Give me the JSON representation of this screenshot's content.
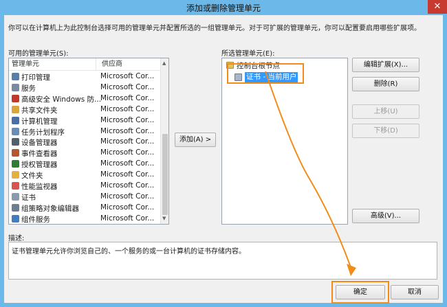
{
  "window": {
    "title": "添加或删除管理单元",
    "close_glyph": "✕"
  },
  "intro_text": "你可以在计算机上为此控制台选择可用的管理单元并配置所选的一组管理单元。对于可扩展的管理单元，你可以配置要启用哪些扩展项。",
  "available": {
    "label": "可用的管理单元(S):",
    "columns": [
      "管理单元",
      "供应商"
    ],
    "items": [
      {
        "name": "打印管理",
        "vendor": "Microsoft Cor...",
        "icon": "printer-icon",
        "color": "#5b7ea6"
      },
      {
        "name": "服务",
        "vendor": "Microsoft Cor...",
        "icon": "services-icon",
        "color": "#7a8aa0"
      },
      {
        "name": "高级安全 Windows 防...",
        "vendor": "Microsoft Cor...",
        "icon": "firewall-icon",
        "color": "#c0392b"
      },
      {
        "name": "共享文件夹",
        "vendor": "Microsoft Cor...",
        "icon": "shared-folder-icon",
        "color": "#d8a63b"
      },
      {
        "name": "计算机管理",
        "vendor": "Microsoft Cor...",
        "icon": "computer-management-icon",
        "color": "#4a6fa5"
      },
      {
        "name": "任务计划程序",
        "vendor": "Microsoft Cor...",
        "icon": "task-scheduler-icon",
        "color": "#6b8db5"
      },
      {
        "name": "设备管理器",
        "vendor": "Microsoft Cor...",
        "icon": "device-manager-icon",
        "color": "#52606d"
      },
      {
        "name": "事件查看器",
        "vendor": "Microsoft Cor...",
        "icon": "event-viewer-icon",
        "color": "#b5562f"
      },
      {
        "name": "授权管理器",
        "vendor": "Microsoft Cor...",
        "icon": "authorization-icon",
        "color": "#2e7d32"
      },
      {
        "name": "文件夹",
        "vendor": "Microsoft Cor...",
        "icon": "folder-icon",
        "color": "#e3b23c"
      },
      {
        "name": "性能监视器",
        "vendor": "Microsoft Cor...",
        "icon": "performance-icon",
        "color": "#d9534f"
      },
      {
        "name": "证书",
        "vendor": "Microsoft Cor...",
        "icon": "certificate-icon",
        "color": "#8a9bb0"
      },
      {
        "name": "组策略对象编辑器",
        "vendor": "Microsoft Cor...",
        "icon": "group-policy-icon",
        "color": "#6d7e92"
      },
      {
        "name": "组件服务",
        "vendor": "Microsoft Cor...",
        "icon": "component-services-icon",
        "color": "#3f7fbf"
      }
    ]
  },
  "add_button": "添加(A) >",
  "selected": {
    "label": "所选管理单元(E):",
    "root": "控制台根节点",
    "child": "证书 - 当前用户",
    "highlight_color": "#3399ff"
  },
  "side_buttons": {
    "edit": "编辑扩展(X)...",
    "remove": "删除(R)",
    "up": "上移(U)",
    "down": "下移(D)",
    "advanced": "高级(V)..."
  },
  "description": {
    "label": "描述:",
    "text": "证书管理单元允许你浏览自己的、一个服务的或一台计算机的证书存储内容。"
  },
  "footer": {
    "ok": "确定",
    "cancel": "取消"
  },
  "annotation_color": "#f28c18"
}
